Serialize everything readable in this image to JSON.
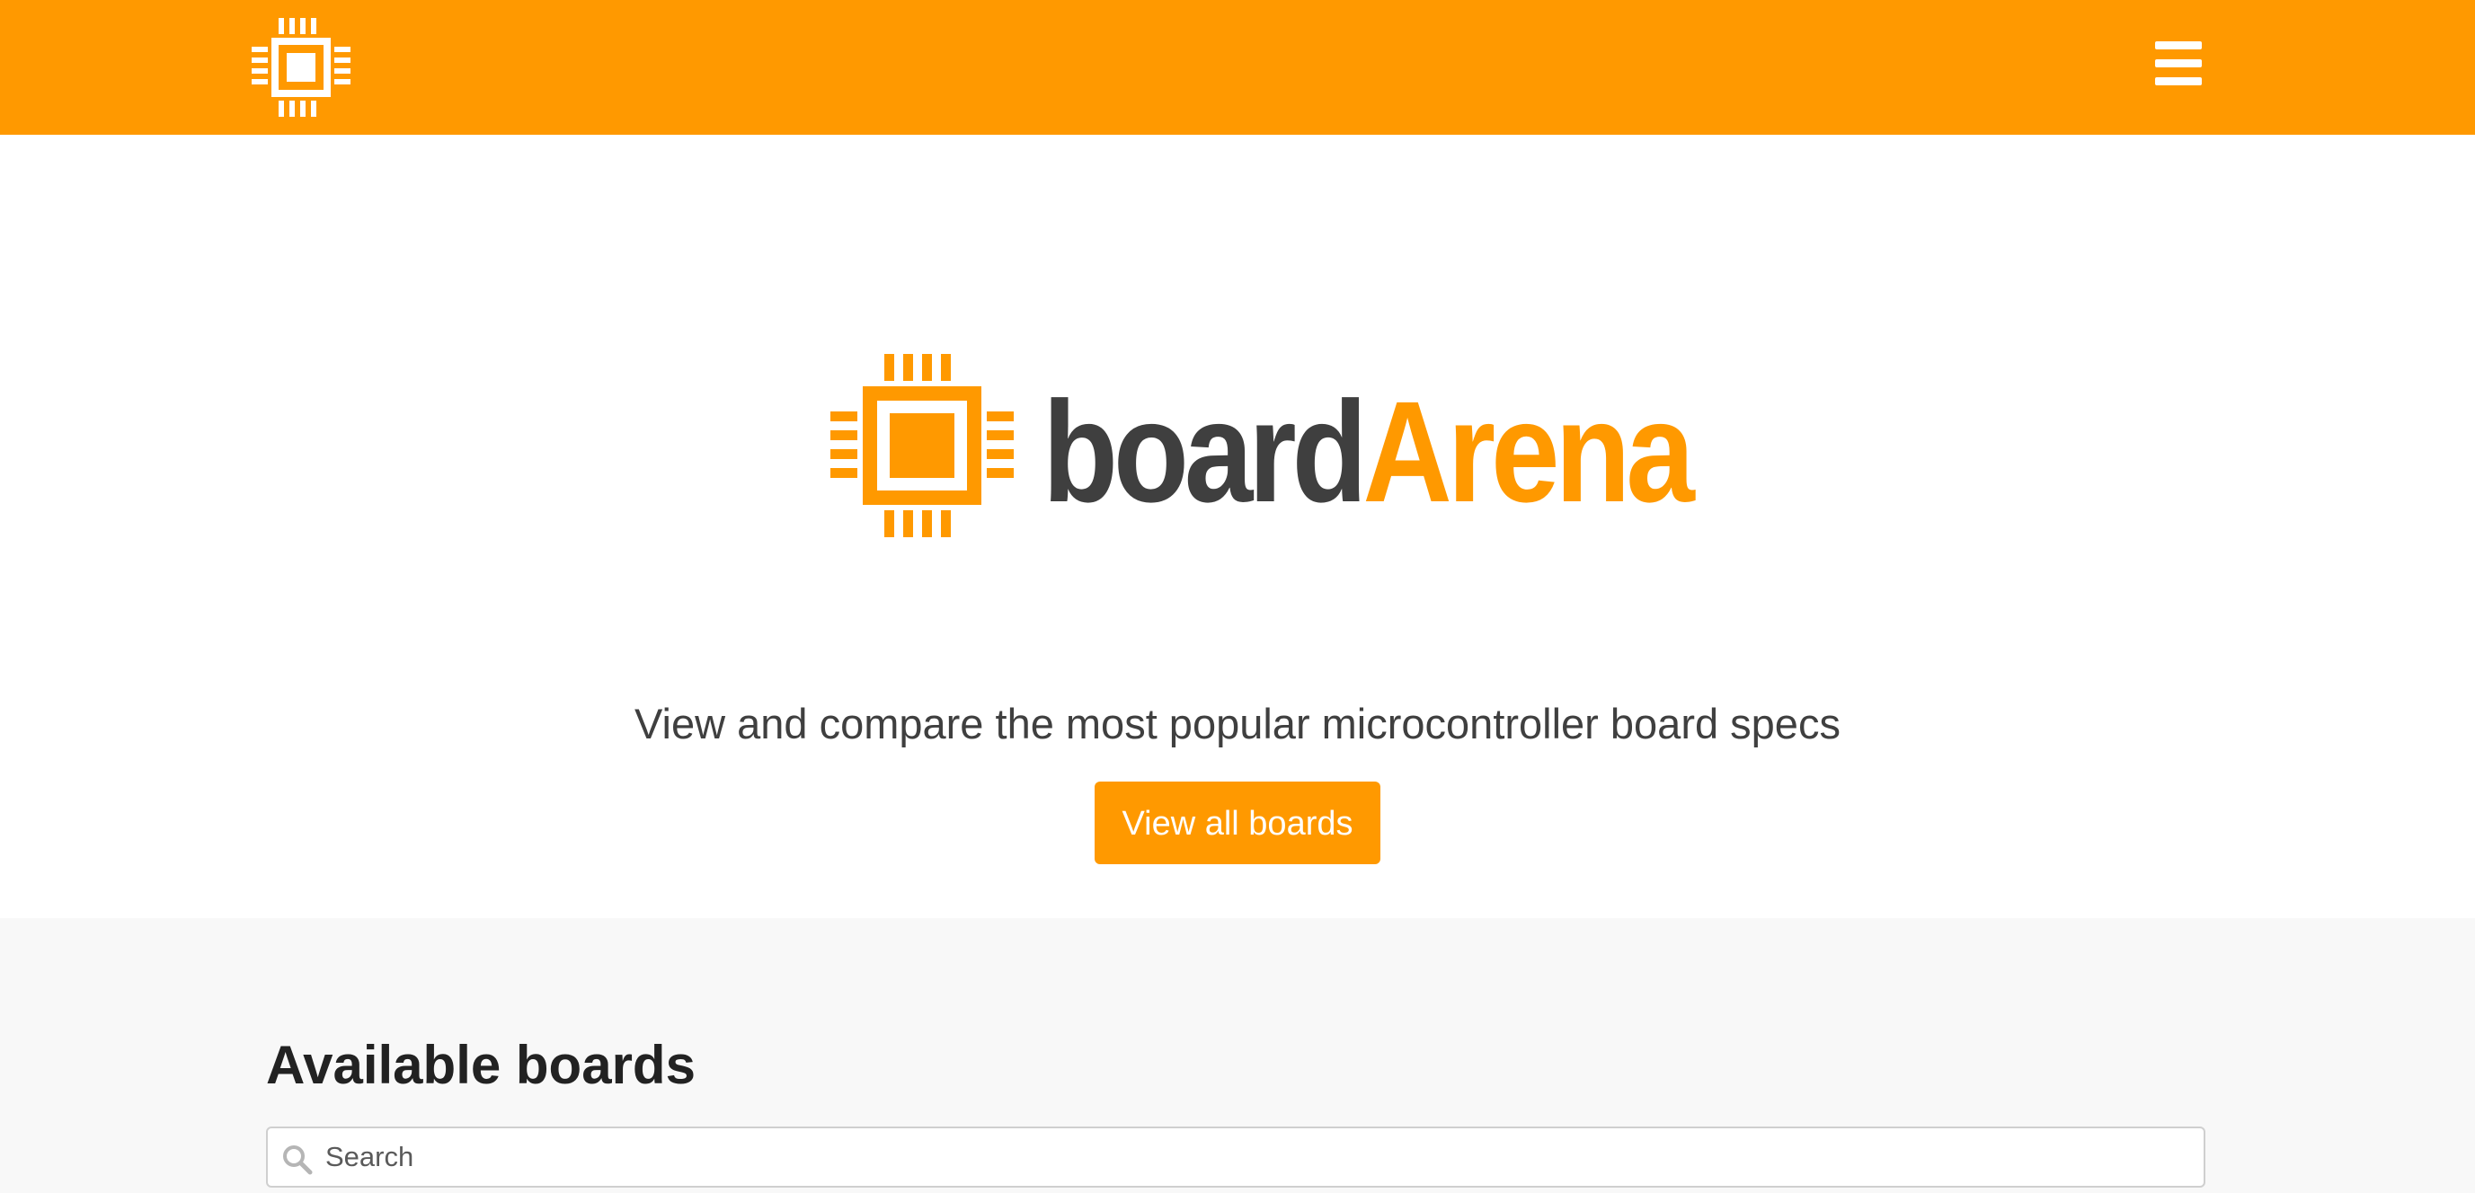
{
  "nav": {
    "logo_icon": "microchip-icon",
    "menu_icon": "hamburger-menu-icon",
    "background_color": "#ff9900"
  },
  "hero": {
    "brand": {
      "part1": "board",
      "part2": "Arena",
      "part1_color": "#3f3f3f",
      "part2_color": "#ff9900",
      "icon": "microchip-icon"
    },
    "tagline": "View and compare the most popular microcontroller board specs",
    "cta_label": "View all boards"
  },
  "boards": {
    "title": "Available boards",
    "search": {
      "placeholder": "Search",
      "value": "",
      "icon": "search-icon"
    }
  }
}
